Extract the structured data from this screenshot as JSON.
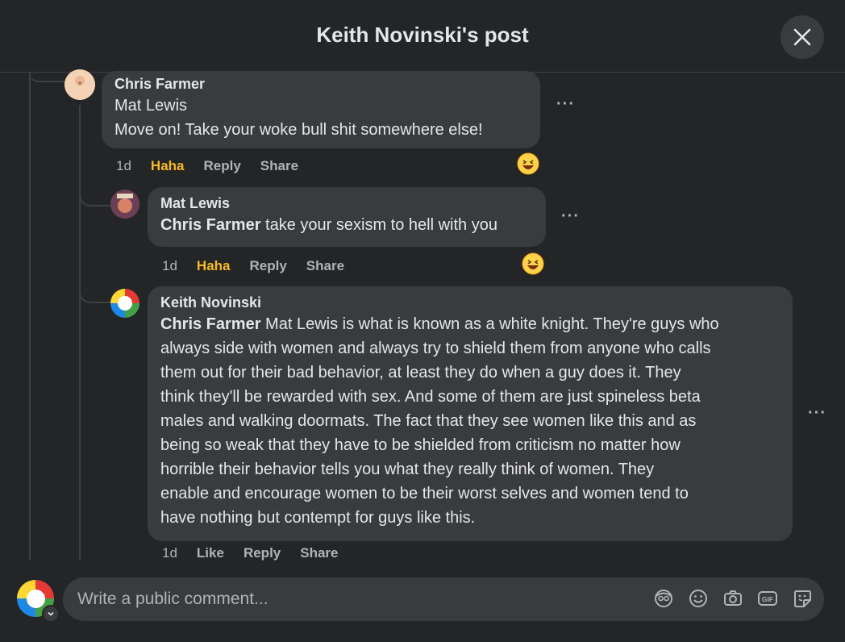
{
  "header": {
    "title": "Keith Novinski's post"
  },
  "comments": [
    {
      "author": "Chris Farmer",
      "mention": "Mat Lewis",
      "text": "Move on! Take your woke bull shit somewhere else!",
      "time": "1d",
      "reaction_label": "Haha",
      "reply_label": "Reply",
      "share_label": "Share",
      "more_label": "···"
    },
    {
      "author": "Mat Lewis",
      "mention": "Chris Farmer",
      "text": " take your sexism to hell with you",
      "time": "1d",
      "reaction_label": "Haha",
      "reply_label": "Reply",
      "share_label": "Share",
      "more_label": "···"
    },
    {
      "author": "Keith Novinski",
      "mention": "Chris Farmer",
      "lines": [
        " Mat Lewis is what is known as a white knight. They're guys who",
        "always side with women and always try to shield them from anyone who calls",
        "them out for their bad behavior, at least they do when a guy does it. They",
        "think they'll be rewarded with sex. And some of them are just spineless beta",
        "males and walking doormats. The fact that they see women like this and as",
        "being so weak that they have to be shielded from criticism no matter how",
        "horrible their behavior tells you what they really think of women. They",
        "enable and encourage women to be their worst selves and women tend to",
        "have nothing but contempt for guys like this."
      ],
      "time": "1d",
      "like_label": "Like",
      "reply_label": "Reply",
      "share_label": "Share",
      "more_label": "···"
    }
  ],
  "composer": {
    "placeholder": "Write a public comment...",
    "icons": [
      "avatar-sticker-icon",
      "emoji-icon",
      "camera-icon",
      "gif-icon",
      "sticker-icon"
    ]
  },
  "colors": {
    "background": "#242526",
    "bubble": "#3a3b3c",
    "haha": "#f7b928",
    "secondary_text": "#b0b3b8"
  }
}
